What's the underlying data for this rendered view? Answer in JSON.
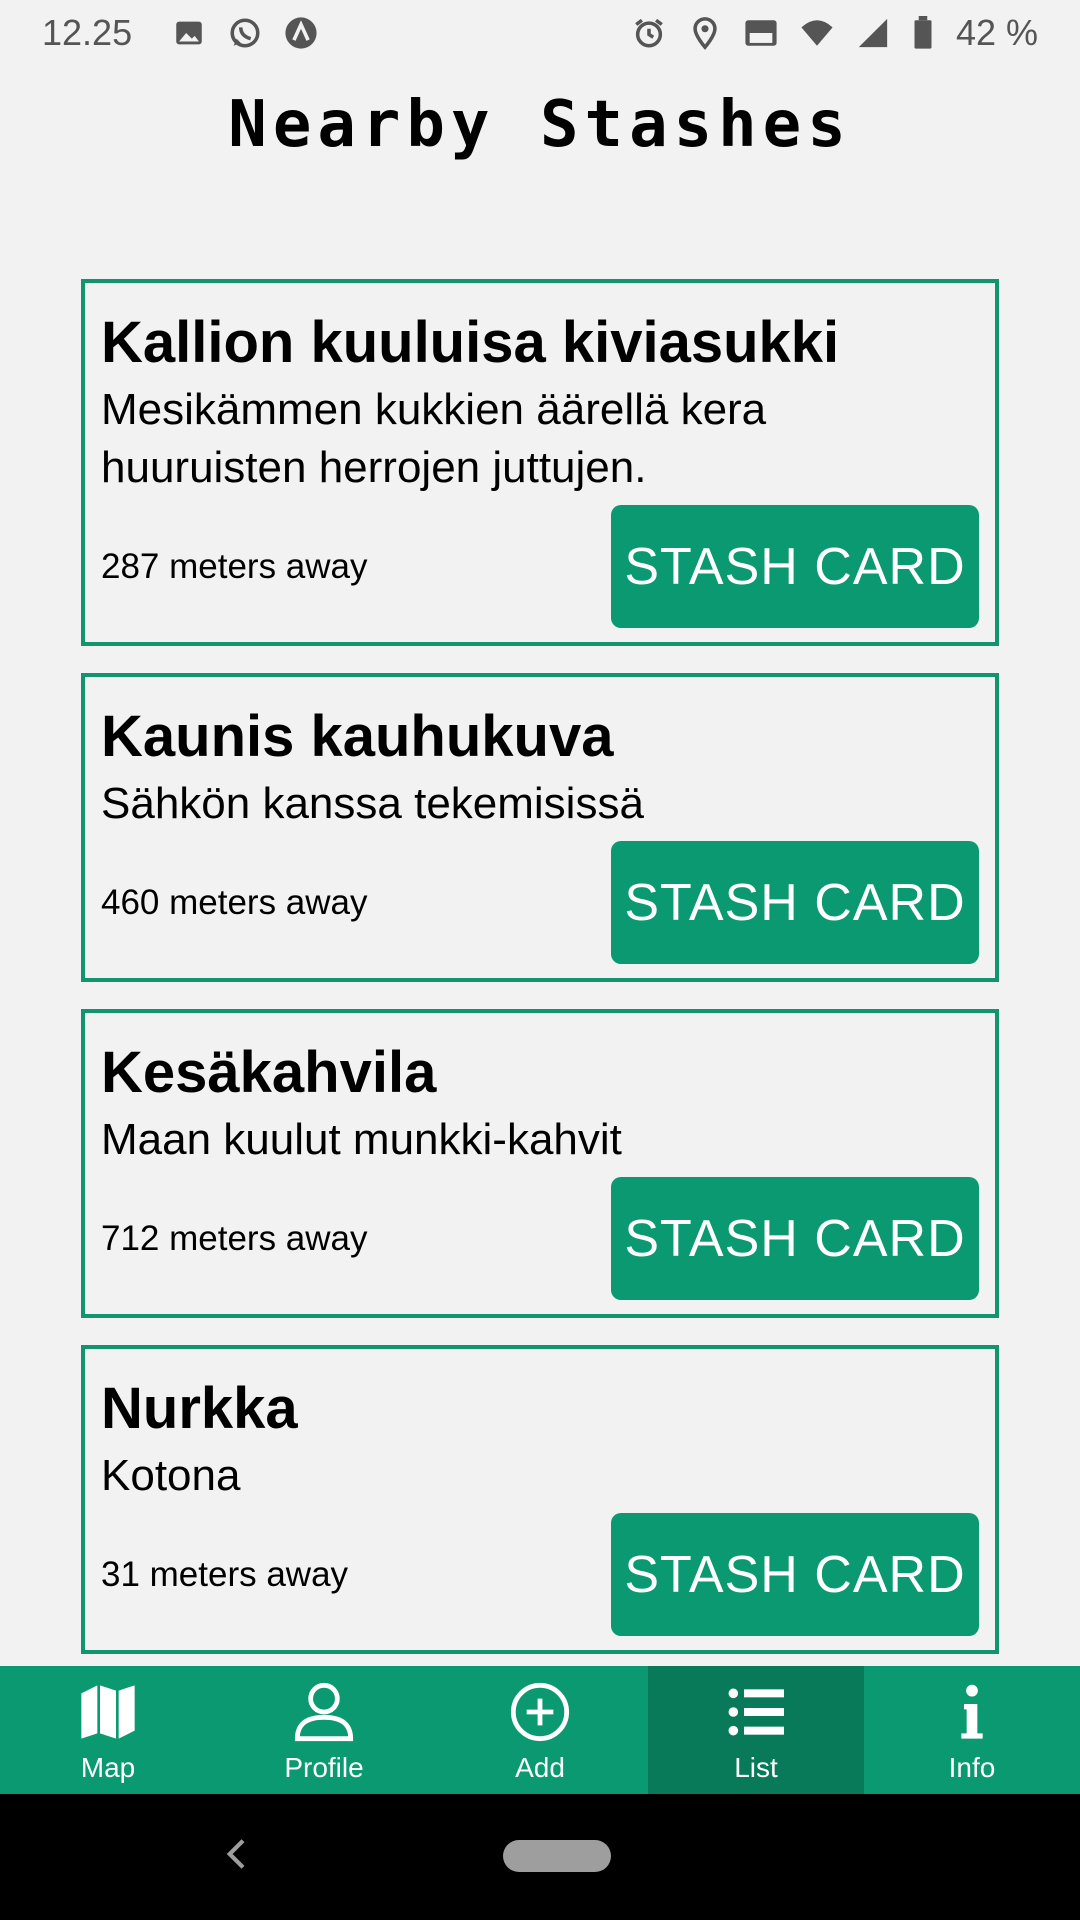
{
  "status_bar": {
    "time": "12.25",
    "battery": "42 %",
    "icons": [
      "image-icon",
      "whatsapp-icon",
      "app-icon",
      "alarm-icon",
      "location-icon",
      "volte-icon",
      "wifi-icon",
      "signal-icon",
      "battery-icon"
    ]
  },
  "page": {
    "title": "Nearby Stashes"
  },
  "stashes": [
    {
      "title": "Kallion kuuluisa kiviasukki",
      "description": "Mesikämmen kukkien äärellä kera huuruisten herrojen juttujen.",
      "distance": "287 meters away",
      "button": "STASH CARD"
    },
    {
      "title": "Kaunis kauhukuva",
      "description": "Sähkön kanssa tekemisissä",
      "distance": "460 meters away",
      "button": "STASH CARD"
    },
    {
      "title": "Kesäkahvila",
      "description": "Maan kuulut munkki-kahvit",
      "distance": "712 meters away",
      "button": "STASH CARD"
    },
    {
      "title": "Nurkka",
      "description": "Kotona",
      "distance": "31 meters away",
      "button": "STASH CARD"
    }
  ],
  "bottom_nav": {
    "items": [
      {
        "label": "Map",
        "icon": "map-icon"
      },
      {
        "label": "Profile",
        "icon": "profile-icon"
      },
      {
        "label": "Add",
        "icon": "add-icon"
      },
      {
        "label": "List",
        "icon": "list-icon",
        "active": true
      },
      {
        "label": "Info",
        "icon": "info-icon"
      }
    ]
  },
  "colors": {
    "accent": "#0a9970",
    "accent_dark": "#087a5a",
    "border": "#12956f",
    "background": "#f2f2f2"
  }
}
